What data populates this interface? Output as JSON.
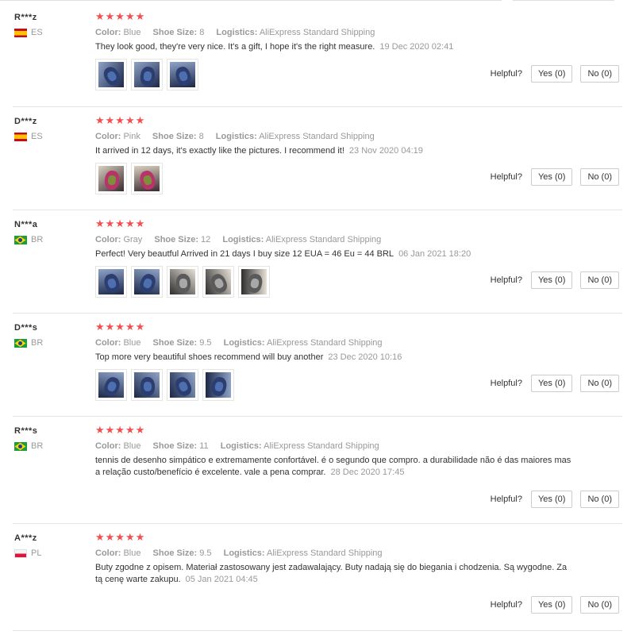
{
  "labels": {
    "color": "Color:",
    "shoe_size": "Shoe Size:",
    "logistics": "Logistics:",
    "helpful": "Helpful?",
    "yes": "Yes (0)",
    "no": "No (0)"
  },
  "stars": "★★★★★",
  "reviews": [
    {
      "name": "R***z",
      "country": "ES",
      "flag": "es",
      "color": "Blue",
      "shoe_size": "8",
      "logistics": "AliExpress Standard Shipping",
      "text": "They look good, they're very nice. It's a gift, I hope it's the right measure.",
      "date": "19 Dec 2020 02:41",
      "photos": 3
    },
    {
      "name": "D***z",
      "country": "ES",
      "flag": "es",
      "color": "Pink",
      "shoe_size": "8",
      "logistics": "AliExpress Standard Shipping",
      "text": "It arrived in 12 days, it's exactly like the pictures. I recommend it!",
      "date": "23 Nov 2020 04:19",
      "photos": 2
    },
    {
      "name": "N***a",
      "country": "BR",
      "flag": "br",
      "color": "Gray",
      "shoe_size": "12",
      "logistics": "AliExpress Standard Shipping",
      "text": "Perfect! Very beautful Arrived in 21 days I buy size 12 EUA = 46 Eu = 44 BRL",
      "date": "06 Jan 2021 18:20",
      "photos": 5
    },
    {
      "name": "D***s",
      "country": "BR",
      "flag": "br",
      "color": "Blue",
      "shoe_size": "9.5",
      "logistics": "AliExpress Standard Shipping",
      "text": "Top more very beautiful shoes recommend will buy another",
      "date": "23 Dec 2020 10:16",
      "photos": 4
    },
    {
      "name": "R***s",
      "country": "BR",
      "flag": "br",
      "color": "Blue",
      "shoe_size": "11",
      "logistics": "AliExpress Standard Shipping",
      "text": "tennis de desenho simpático e extremamente confortável. é o segundo que compro. a durabilidade não é das maiores mas a relação custo/benefício é excelente. vale a pena comprar.",
      "date": "28 Dec 2020 17:45",
      "photos": 0
    },
    {
      "name": "A***z",
      "country": "PL",
      "flag": "pl",
      "color": "Blue",
      "shoe_size": "9.5",
      "logistics": "AliExpress Standard Shipping",
      "text": "Buty zgodne z opisem. Materiał zastosowany jest zadawalający. Buty nadają się do biegania i chodzenia. Są wygodne. Za tą cenę warte zakupu.",
      "date": "05 Jan 2021 04:45",
      "photos": 0
    }
  ]
}
